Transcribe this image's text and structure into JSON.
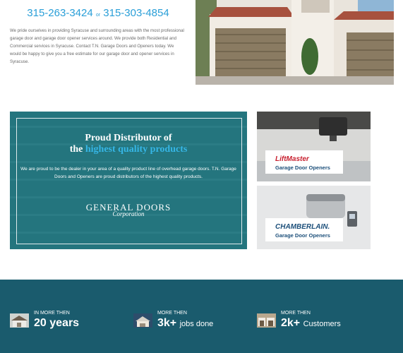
{
  "contact": {
    "phone1": "315-263-3424",
    "or": "or",
    "phone2": "315-303-4854",
    "intro": "We pride ourselves in providing Syracuse and surrounding areas with the most professional garage door and garage door opener services around. We provide both Residential and Commercial services in Syracuse. Contact T.N. Garage Doors and Openers today. We would be happy to give you a free estimate for our garage door and opener services in Syracuse."
  },
  "banner": {
    "title_line1": "Proud Distributor of",
    "title_the": "the",
    "title_highlight": "highest quality products",
    "subtitle": "We are proud to be the dealer in your area of a quality product line of overhead garage doors. T.N. Garage Doors and Openers are proud distributors of the highest quality products.",
    "logo_line1": "GENERAL DOORS",
    "logo_line2": "Corporation"
  },
  "products": [
    {
      "brand": "LiftMaster",
      "label": "Garage Door Openers"
    },
    {
      "brand": "CHAMBERLAIN.",
      "label": "Garage Door Openers"
    }
  ],
  "stats": [
    {
      "caption": "IN MORE THEN",
      "value": "20 years",
      "unit": ""
    },
    {
      "caption": "MORE THEN",
      "value": "3k+",
      "unit": "jobs done"
    },
    {
      "caption": "MORE THEN",
      "value": "2k+",
      "unit": "Customers"
    }
  ],
  "colors": {
    "accent": "#2a9fd8",
    "stats_bg": "#1a5b6d",
    "banner_overlay": "#2a7f86",
    "liftmaster_red": "#c8202f",
    "chamberlain_blue": "#1c4f7a"
  }
}
